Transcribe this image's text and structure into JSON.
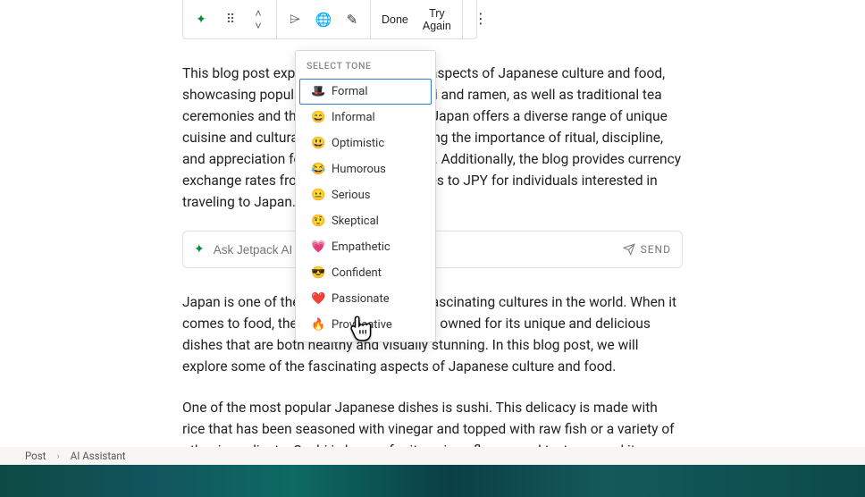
{
  "toolbar": {
    "done_label": "Done",
    "tryagain_label": "Try Again"
  },
  "tone_dropdown": {
    "header": "SELECT TONE",
    "items": [
      {
        "emoji": "🎩",
        "label": "Formal"
      },
      {
        "emoji": "😄",
        "label": "Informal"
      },
      {
        "emoji": "😃",
        "label": "Optimistic"
      },
      {
        "emoji": "😂",
        "label": "Humorous"
      },
      {
        "emoji": "😐",
        "label": "Serious"
      },
      {
        "emoji": "🤨",
        "label": "Skeptical"
      },
      {
        "emoji": "💗",
        "label": "Empathetic"
      },
      {
        "emoji": "😎",
        "label": "Confident"
      },
      {
        "emoji": "❤️",
        "label": "Passionate"
      },
      {
        "emoji": "🔥",
        "label": "Provocative"
      }
    ],
    "selected_index": 0
  },
  "paragraphs": {
    "p1": "This blog post explores the rich culinary aspects of Japanese culture and food, showcasing popular dishes such as sushi and ramen, as well as traditional tea ceremonies and the celebration of sake. Japan offers a diverse range of unique cuisine and cultural traditions, emphasizing the importance of ritual, discipline, and appreciation for the present moment. Additionally, the blog provides currency exchange rates from four major currencies to JPY for individuals interested in traveling to Japan.",
    "p2": "Japan is one of the most culturally rich, fascinating cultures in the world. When it comes to food, the country has long been owned for its unique and delicious dishes that are both healthy and visually stunning. In this blog post, we will explore some of the fascinating aspects of Japanese culture and food.",
    "p3": "One of the most popular Japanese dishes is sushi. This delicacy is made with rice that has been seasoned with vinegar and topped with raw fish or a variety of other ingredients. Sushi is known for its unique flavors and textures, and it represents an"
  },
  "ask_bar": {
    "placeholder": "Ask Jetpack AI",
    "send_label": "SEND"
  },
  "breadcrumb": {
    "root": "Post",
    "current": "AI Assistant"
  }
}
